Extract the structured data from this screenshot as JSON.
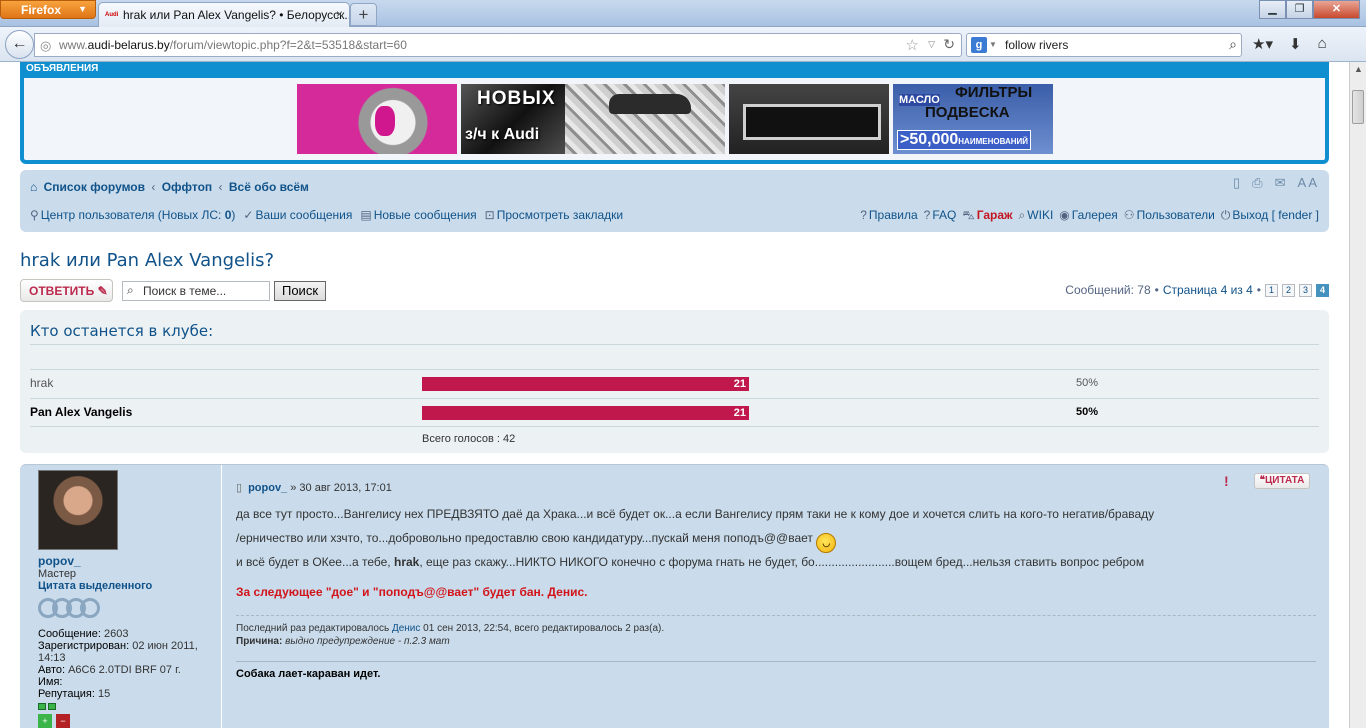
{
  "browser": {
    "menu_button": "Firefox",
    "tab_title": "hrak или Pan Alex Vangelis? • Белорусск...",
    "url_prefix": "www.",
    "url_host": "audi-belarus.by",
    "url_path": "/forum/viewtopic.php?f=2&t=53518&start=60",
    "search_value": "follow rivers"
  },
  "ads": {
    "header": "ОБЪЯВЛЕНИЯ",
    "ad2_line1": "НОВЫХ",
    "ad2_line2": "з/ч к Audi",
    "ad5_line1": "МАСЛО",
    "ad5_line2": "ФИЛЬТРЫ",
    "ad5_line3": "ПОДВЕСКА",
    "ad5_big": ">50,000",
    "ad5_small": "НАИМЕНОВАНИЙ"
  },
  "breadcrumb": {
    "items": [
      "Список форумов",
      "Оффтоп",
      "Всё обо всём"
    ]
  },
  "tools": {
    "font_label": "A A"
  },
  "user_links": {
    "ucp": "Центр пользователя (Новых ЛС: ",
    "ucp_count": "0",
    "ucp_end": ")",
    "your_posts": "Ваши сообщения",
    "new_posts": "Новые сообщения",
    "bookmarks": "Просмотреть закладки"
  },
  "right_links": {
    "rules": "Правила",
    "faq": "FAQ",
    "garage": "Гараж",
    "wiki": "WIKI",
    "gallery": "Галерея",
    "users": "Пользователи",
    "logout": "Выход [ fender ]"
  },
  "topic": {
    "title": "hrak или Pan Alex Vangelis?",
    "reply_label": "ОТВЕТИТЬ",
    "search_placeholder": "Поиск в теме...",
    "search_button": "Поиск",
    "posts_count": "Сообщений: 78",
    "page_label": "Страница 4 из 4",
    "pages": [
      "1",
      "2",
      "3",
      "4"
    ]
  },
  "poll": {
    "question": "Кто останется в клубе:",
    "options": [
      {
        "name": "hrak",
        "votes": "21",
        "percent": "50%",
        "share": 0.5
      },
      {
        "name": "Pan Alex Vangelis",
        "votes": "21",
        "percent": "50%",
        "share": 0.5
      }
    ],
    "total": "Всего голосов : 42"
  },
  "post": {
    "author": "popov_",
    "rank": "Мастер",
    "rank_label": "Цитата выделенного",
    "posts": "2603",
    "posts_label": "Сообщение:",
    "registered_label": "Зарегистрирован:",
    "registered": "02 июн 2011, 14:13",
    "auto_label": "Авто:",
    "auto": "A6C6 2.0TDI BRF 07 г.",
    "name_label": "Имя:",
    "rep_label": "Репутация:",
    "reputation": "15",
    "date": "30 авг 2013, 17:01",
    "quote_label": "ЦИТАТА",
    "line1": "да все тут просто...Вангелису нех ПРЕДВЗЯТО даё да Храка...и всё будет ок...а если Вангелису прям таки не к кому дое и хочется слить на кого-то негатив/браваду",
    "line2": "/ерничество или хзчто, то...добровольно предоставлю свою кандидатуру...пускай меня поподъ@@вает",
    "line3_start": "и всё будет в ОКее...а тебе, ",
    "line3_bold": "hrak",
    "line3_end": ", еще раз скажу...НИКТО НИКОГО конечно с форума гнать не будет, бо........................вощем бред...нельзя ставить вопрос ребром",
    "moderator_warning": "За следующее \"дое\" и \"поподъ@@вает\" будет бан. Денис.",
    "edit_prefix": "Последний раз редактировалось ",
    "edit_user": "Денис",
    "edit_suffix": " 01 сен 2013, 22:54, всего редактировалось 2 раз(а).",
    "reason_label": "Причина:",
    "reason": "выдно предупреждение - п.2.3 мат",
    "signature": "Собака лает-караван идет."
  },
  "colors": {
    "accent": "#105289",
    "poll_bar": "#c0174d",
    "panel": "#cadceb",
    "warning": "#d2141a"
  }
}
